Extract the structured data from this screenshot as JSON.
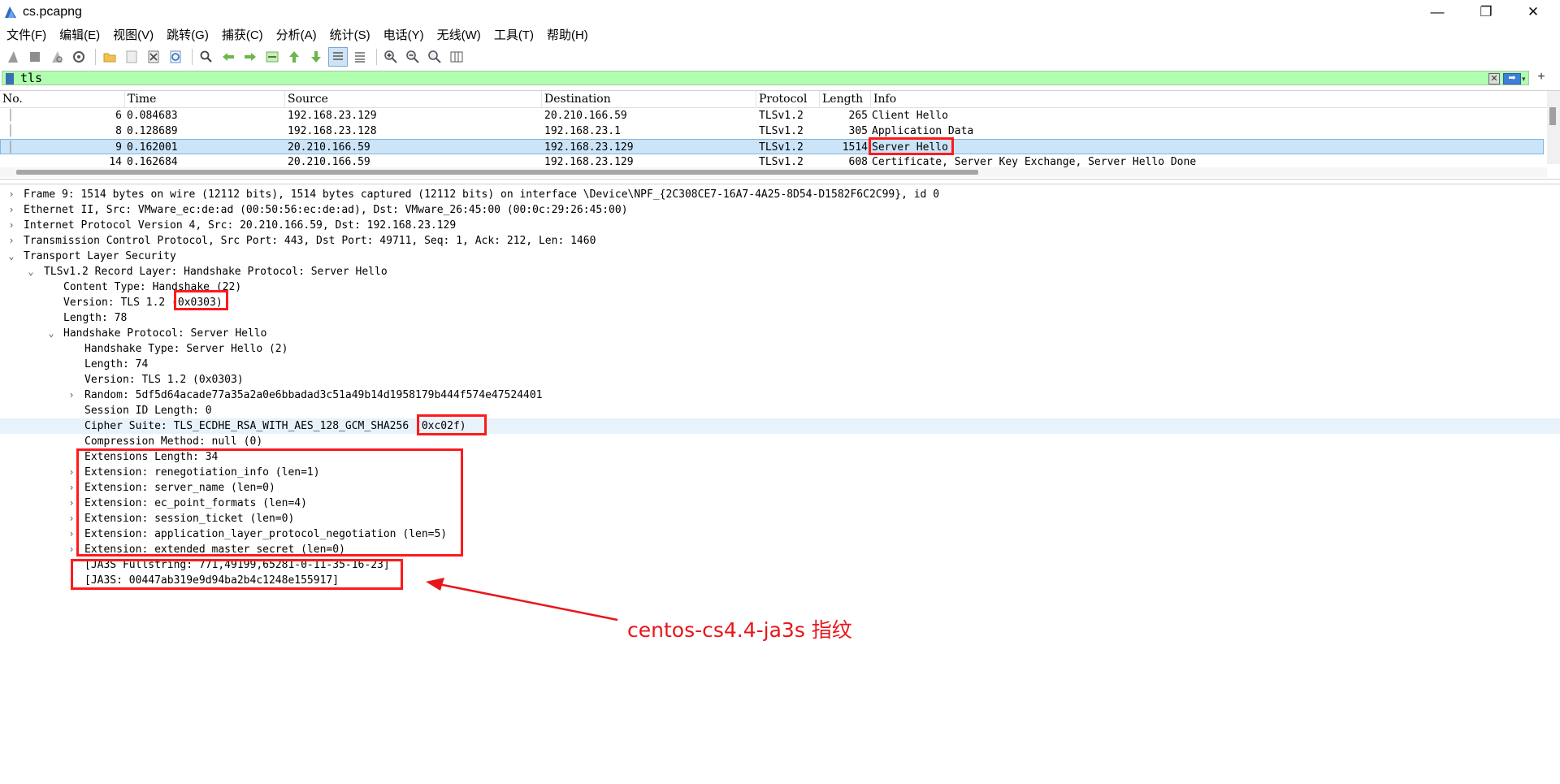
{
  "window": {
    "title": "cs.pcapng",
    "minimize": "—",
    "maximize": "❐",
    "close": "✕"
  },
  "menu": [
    "文件(F)",
    "编辑(E)",
    "视图(V)",
    "跳转(G)",
    "捕获(C)",
    "分析(A)",
    "统计(S)",
    "电话(Y)",
    "无线(W)",
    "工具(T)",
    "帮助(H)"
  ],
  "toolbar_icons": [
    "shark-fin-start-icon",
    "stop-square-icon",
    "restart-fin-icon",
    "capture-options-gear-icon",
    "open-folder-icon",
    "save-file-icon",
    "close-file-icon",
    "reload-icon",
    "find-packet-icon",
    "go-back-icon",
    "go-forward-icon",
    "go-to-packet-icon",
    "go-first-icon",
    "go-last-icon",
    "autoscroll-icon",
    "colorize-icon",
    "zoom-in-icon",
    "zoom-out-icon",
    "zoom-normal-icon",
    "resize-columns-icon"
  ],
  "filter": {
    "value": "tls",
    "clear": "✕",
    "apply": "➡",
    "dropdown": "▾",
    "add": "+"
  },
  "packet_list": {
    "columns": [
      "No.",
      "Time",
      "Source",
      "Destination",
      "Protocol",
      "Length",
      "Info"
    ],
    "rows": [
      {
        "no": "6",
        "time": "0.084683",
        "src": "192.168.23.129",
        "dst": "20.210.166.59",
        "proto": "TLSv1.2",
        "len": "265",
        "info": "Client Hello"
      },
      {
        "no": "8",
        "time": "0.128689",
        "src": "192.168.23.128",
        "dst": "192.168.23.1",
        "proto": "TLSv1.2",
        "len": "305",
        "info": "Application Data"
      },
      {
        "no": "9",
        "time": "0.162001",
        "src": "20.210.166.59",
        "dst": "192.168.23.129",
        "proto": "TLSv1.2",
        "len": "1514",
        "info": "Server Hello"
      },
      {
        "no": "14",
        "time": "0.162684",
        "src": "20.210.166.59",
        "dst": "192.168.23.129",
        "proto": "TLSv1.2",
        "len": "608",
        "info": "Certificate, Server Key Exchange, Server Hello Done"
      }
    ],
    "selected_row": 2
  },
  "details": [
    {
      "text": "Frame 9: 1514 bytes on wire (12112 bits), 1514 bytes captured (12112 bits) on interface \\Device\\NPF_{2C308CE7-16A7-4A25-8D54-D1582F6C2C99}, id 0",
      "arrow": "›"
    },
    {
      "text": "Ethernet II, Src: VMware_ec:de:ad (00:50:56:ec:de:ad), Dst: VMware_26:45:00 (00:0c:29:26:45:00)",
      "arrow": "›"
    },
    {
      "text": "Internet Protocol Version 4, Src: 20.210.166.59, Dst: 192.168.23.129",
      "arrow": "›"
    },
    {
      "text": "Transmission Control Protocol, Src Port: 443, Dst Port: 49711, Seq: 1, Ack: 212, Len: 1460",
      "arrow": "›"
    },
    {
      "text": "Transport Layer Security",
      "arrow": "⌄"
    },
    {
      "text": "TLSv1.2 Record Layer: Handshake Protocol: Server Hello",
      "arrow": "⌄"
    },
    {
      "text": "Content Type: Handshake (22)",
      "arrow": ""
    },
    {
      "text": "Version: TLS 1.2 (0x0303)",
      "arrow": ""
    },
    {
      "text": "Length: 78",
      "arrow": ""
    },
    {
      "text": "Handshake Protocol: Server Hello",
      "arrow": "⌄"
    },
    {
      "text": "Handshake Type: Server Hello (2)",
      "arrow": ""
    },
    {
      "text": "Length: 74",
      "arrow": ""
    },
    {
      "text": "Version: TLS 1.2 (0x0303)",
      "arrow": ""
    },
    {
      "text": "Random: 5df5d64acade77a35a2a0e6bbadad3c51a49b14d1958179b444f574e47524401",
      "arrow": "›"
    },
    {
      "text": "Session ID Length: 0",
      "arrow": ""
    },
    {
      "text": "Cipher Suite: TLS_ECDHE_RSA_WITH_AES_128_GCM_SHA256 (0xc02f)",
      "arrow": ""
    },
    {
      "text": "Compression Method: null (0)",
      "arrow": ""
    },
    {
      "text": "Extensions Length: 34",
      "arrow": ""
    },
    {
      "text": "Extension: renegotiation_info (len=1)",
      "arrow": "›"
    },
    {
      "text": "Extension: server_name (len=0)",
      "arrow": "›"
    },
    {
      "text": "Extension: ec_point_formats (len=4)",
      "arrow": "›"
    },
    {
      "text": "Extension: session_ticket (len=0)",
      "arrow": "›"
    },
    {
      "text": "Extension: application_layer_protocol_negotiation (len=5)",
      "arrow": "›"
    },
    {
      "text": "Extension: extended_master_secret (len=0)",
      "arrow": "›"
    },
    {
      "text": "[JA3S Fullstring: 771,49199,65281-0-11-35-16-23]",
      "arrow": ""
    },
    {
      "text": "[JA3S: 00447ab319e9d94ba2b4c1248e155917]",
      "arrow": ""
    }
  ],
  "selected_detail": 15,
  "annotation": {
    "label": "centos-cs4.4-ja3s 指纹",
    "color": "#e8161b"
  }
}
